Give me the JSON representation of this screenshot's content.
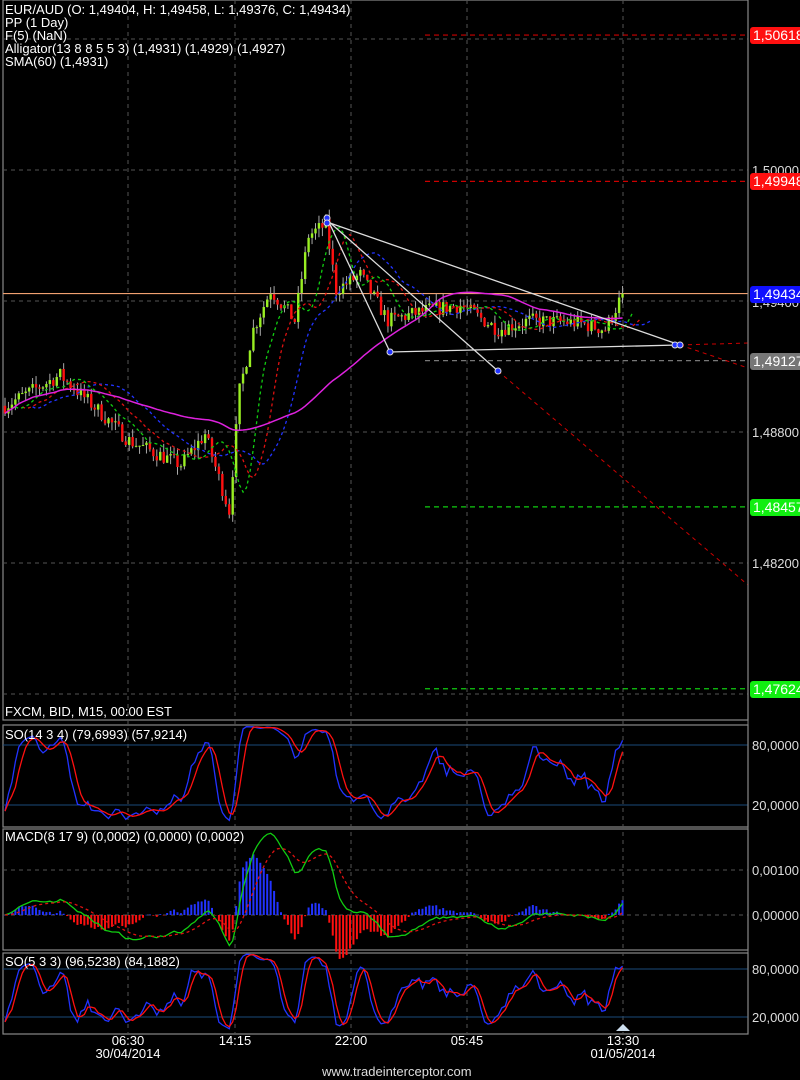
{
  "chart_data": {
    "type": "candlestick",
    "symbol": "EUR/AUD",
    "ohlc_info": "EUR/AUD (O: 1,49404, H: 1,49458, L: 1,49376, C: 1,49434)",
    "indicators_text": [
      "PP (1 Day)",
      "F(5) (NaN)",
      "Alligator(13 8 8 5 5 3) (1,4931) (1,4929) (1,4927)",
      "SMA(60) (1,4931)"
    ],
    "feed_info": "FXCM, BID, M15, 00:00 EST",
    "candle_count": 180,
    "price_path": [
      [
        0,
        1.4892
      ],
      [
        16,
        1.4906
      ],
      [
        27,
        1.489
      ],
      [
        36,
        1.4876
      ],
      [
        51,
        1.4865
      ],
      [
        58,
        1.4879
      ],
      [
        65,
        1.4844
      ],
      [
        68,
        1.4899
      ],
      [
        72,
        1.4927
      ],
      [
        77,
        1.4945
      ],
      [
        84,
        1.4931
      ],
      [
        88,
        1.497
      ],
      [
        93,
        1.4975
      ],
      [
        96,
        1.4945
      ],
      [
        103,
        1.4952
      ],
      [
        111,
        1.4931
      ],
      [
        123,
        1.4936
      ],
      [
        132,
        1.4938
      ],
      [
        143,
        1.4927
      ],
      [
        152,
        1.4931
      ],
      [
        166,
        1.493
      ],
      [
        174,
        1.4927
      ],
      [
        179,
        1.4943
      ]
    ],
    "y_ticks": [
      "1,50000",
      "1,49400",
      "1,48800",
      "1,48200"
    ],
    "y_tick_values": [
      1.5,
      1.494,
      1.488,
      1.482,
      1.506,
      1.476
    ],
    "price_tags": [
      {
        "text": "1,50618",
        "value": 1.50618,
        "color": "#ff1010",
        "line": "#cc0000"
      },
      {
        "text": "1,49948",
        "value": 1.49948,
        "color": "#ff1010",
        "line": "#cc0000"
      },
      {
        "text": "1,49434",
        "value": 1.49434,
        "color": "#1010ff",
        "line": "#f0a070"
      },
      {
        "text": "1,49127",
        "value": 1.49127,
        "color": "#777777",
        "line": "#777777"
      },
      {
        "text": "1,48457",
        "value": 1.48457,
        "color": "#11ee11",
        "line": "#11cc11"
      },
      {
        "text": "1,47624",
        "value": 1.47624,
        "color": "#11ee11",
        "line": "#11cc11"
      }
    ],
    "so1": {
      "title": "SO(14 3 4) (79,6993) (57,9214)",
      "levels": [
        "80,0000",
        "20,0000"
      ]
    },
    "macd": {
      "title": "MACD(8 17 9) (0,0002) (0,0000) (0,0002)",
      "levels": [
        "0,00100",
        "0,00000"
      ]
    },
    "so2": {
      "title": "SO(5 3 3) (96,5238) (84,1882)",
      "levels": [
        "80,0000",
        "20,0000"
      ]
    },
    "x_ticks": [
      {
        "time": "06:30",
        "date": "30/04/2014"
      },
      {
        "time": "14:15",
        "date": ""
      },
      {
        "time": "22:00",
        "date": ""
      },
      {
        "time": "05:45",
        "date": ""
      },
      {
        "time": "13:30",
        "date": "01/05/2014"
      }
    ],
    "colors": {
      "up": "#99ee22",
      "down": "#ff1010",
      "sma": "#dd22dd",
      "jaw": "#2233ff",
      "teeth": "#dd1111",
      "lips": "#11cc11"
    }
  },
  "watermark": "www.tradeinterceptor.com"
}
